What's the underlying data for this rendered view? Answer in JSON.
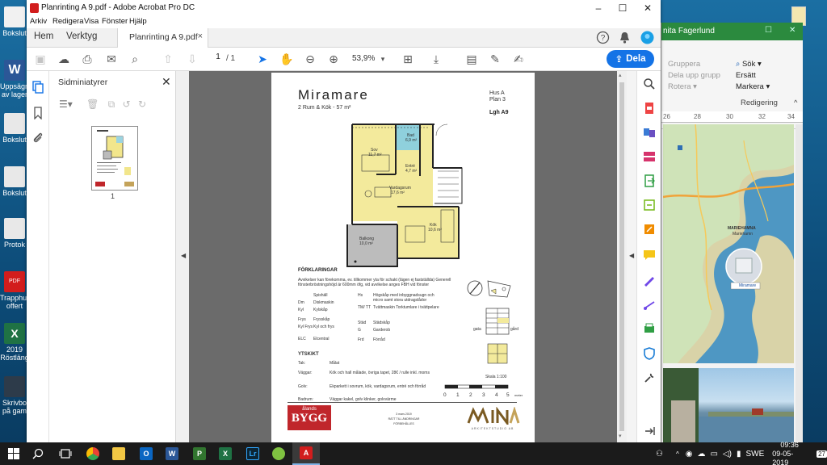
{
  "window": {
    "title": "Planrinting A 9.pdf - Adobe Acrobat Pro DC",
    "controls": {
      "minimize": "–",
      "maximize": "☐",
      "close": "✕"
    }
  },
  "menu": [
    "Arkiv",
    "Redigera",
    "Visa",
    "Fönster",
    "Hjälp"
  ],
  "tabs": {
    "home": "Hem",
    "tools": "Verktyg",
    "document": "Planrinting A 9.pdf",
    "close": "×"
  },
  "toolbar": {
    "page_current": "1",
    "page_total": "/ 1",
    "zoom": "53,9%",
    "share_label": "Dela"
  },
  "panel": {
    "title": "Sidminiatyrer",
    "thumb_label": "1"
  },
  "pdf": {
    "title": "Miramare",
    "subtitle": "2 Rum & Kök - 57 m²",
    "hus": "Hus A",
    "plan": "Plan 3",
    "lgh": "Lgh A9",
    "rooms": {
      "sovrum": "Sov",
      "sov_area": "11,7 m²",
      "bad": "Bad",
      "bad_area": "6,9 m²",
      "entre": "Entré",
      "entre_area": "4,7 m²",
      "vardagsrum": "Vardagsrum",
      "vardag_area": "17,6 m²",
      "kok": "Kök",
      "kok_area": "10,6 m²",
      "balkong": "Balkong",
      "balkong_area": "10,0 m²"
    },
    "legend_heading": "FÖRKLARINGAR",
    "legend_text": "Avvikelser kan förekomma, ev. tillkommer yta för schakt (lägen ej fastställda) Generell fönsterbröstningshöjd är 600mm öfg, vid avvikelse anges FBH vid fönster",
    "legend_left": [
      {
        "k": "",
        "v": "Spishäll"
      },
      {
        "k": "Dm",
        "v": "Diskmaskin"
      },
      {
        "k": "Kyl",
        "v": "Kylskåp"
      },
      {
        "k": "Frys",
        "v": "Frysskåp"
      },
      {
        "k": "Kyl Frys",
        "v": "Kyl och frys"
      },
      {
        "k": "ELC",
        "v": "Elcentral"
      }
    ],
    "legend_right": [
      {
        "k": "Hs",
        "v": "Högskåp med inbyggnadsugn och micro samt stora utdragslådor"
      },
      {
        "k": "TM/ TT",
        "v": "Tvättmaskin Torktumlare i tvättpelare"
      },
      {
        "k": "Städ",
        "v": "Städskåp"
      },
      {
        "k": "G",
        "v": "Garderob"
      },
      {
        "k": "Frd",
        "v": "Förråd"
      }
    ],
    "ytskikt_heading": "YTSKIKT",
    "ytskikt": [
      {
        "k": "Tak:",
        "v": "Målat"
      },
      {
        "k": "Väggar:",
        "v": "Kök och hall målade, övriga tapet, 28€ / rulle inkl. moms"
      },
      {
        "k": "Golv:",
        "v": "Ekparkett i sovrum, kök, vardagsrum, entré och förråd"
      },
      {
        "k": "Badrum:",
        "v": "Väggar kakel, golv klinker, golvvärme"
      }
    ],
    "gata": "gata",
    "gard": "gård",
    "skala": "Skala 1:100",
    "scale_nums": [
      "0",
      "1",
      "2",
      "3",
      "4",
      "5"
    ],
    "scale_unit": "meter",
    "bygg_top": "ålands",
    "bygg_main": "BYGG",
    "mina_sub": "ARKITEKTSTUDIO AB",
    "date_note": "3 mars 2019\nRÄTT TILL ÄNDRINGAR FÖRBEHÅLLES"
  },
  "bg_window": {
    "title": "nita Fagerlund",
    "ribbon": {
      "gruppera": "Gruppera",
      "dela_upp": "Dela upp grupp",
      "rotera": "Rotera ▾",
      "sok": "Sök ▾",
      "ersatt": "Ersätt",
      "markera": "Markera ▾",
      "redigering": "Redigering"
    },
    "ruler": [
      "26",
      "28",
      "30",
      "32",
      "34"
    ],
    "map_label": "MARIEHAMNA",
    "map_label2": "Mariehamn",
    "map_tag": "Miramare"
  },
  "desktop_icons": [
    "Bokslut",
    "Uppsägn av lager",
    "Bokslut",
    "Bokslut",
    "Protok",
    "Trapphus offert",
    "2019 Röstläng",
    "Skrivbo på gam"
  ],
  "tray": {
    "lang": "SWE",
    "time": "09:36",
    "date": "09-05-2019",
    "notif": "27"
  },
  "colors": {
    "accent": "#1473e6",
    "bygg_red": "#c0262b",
    "acrobat_red": "#d21d1d"
  }
}
